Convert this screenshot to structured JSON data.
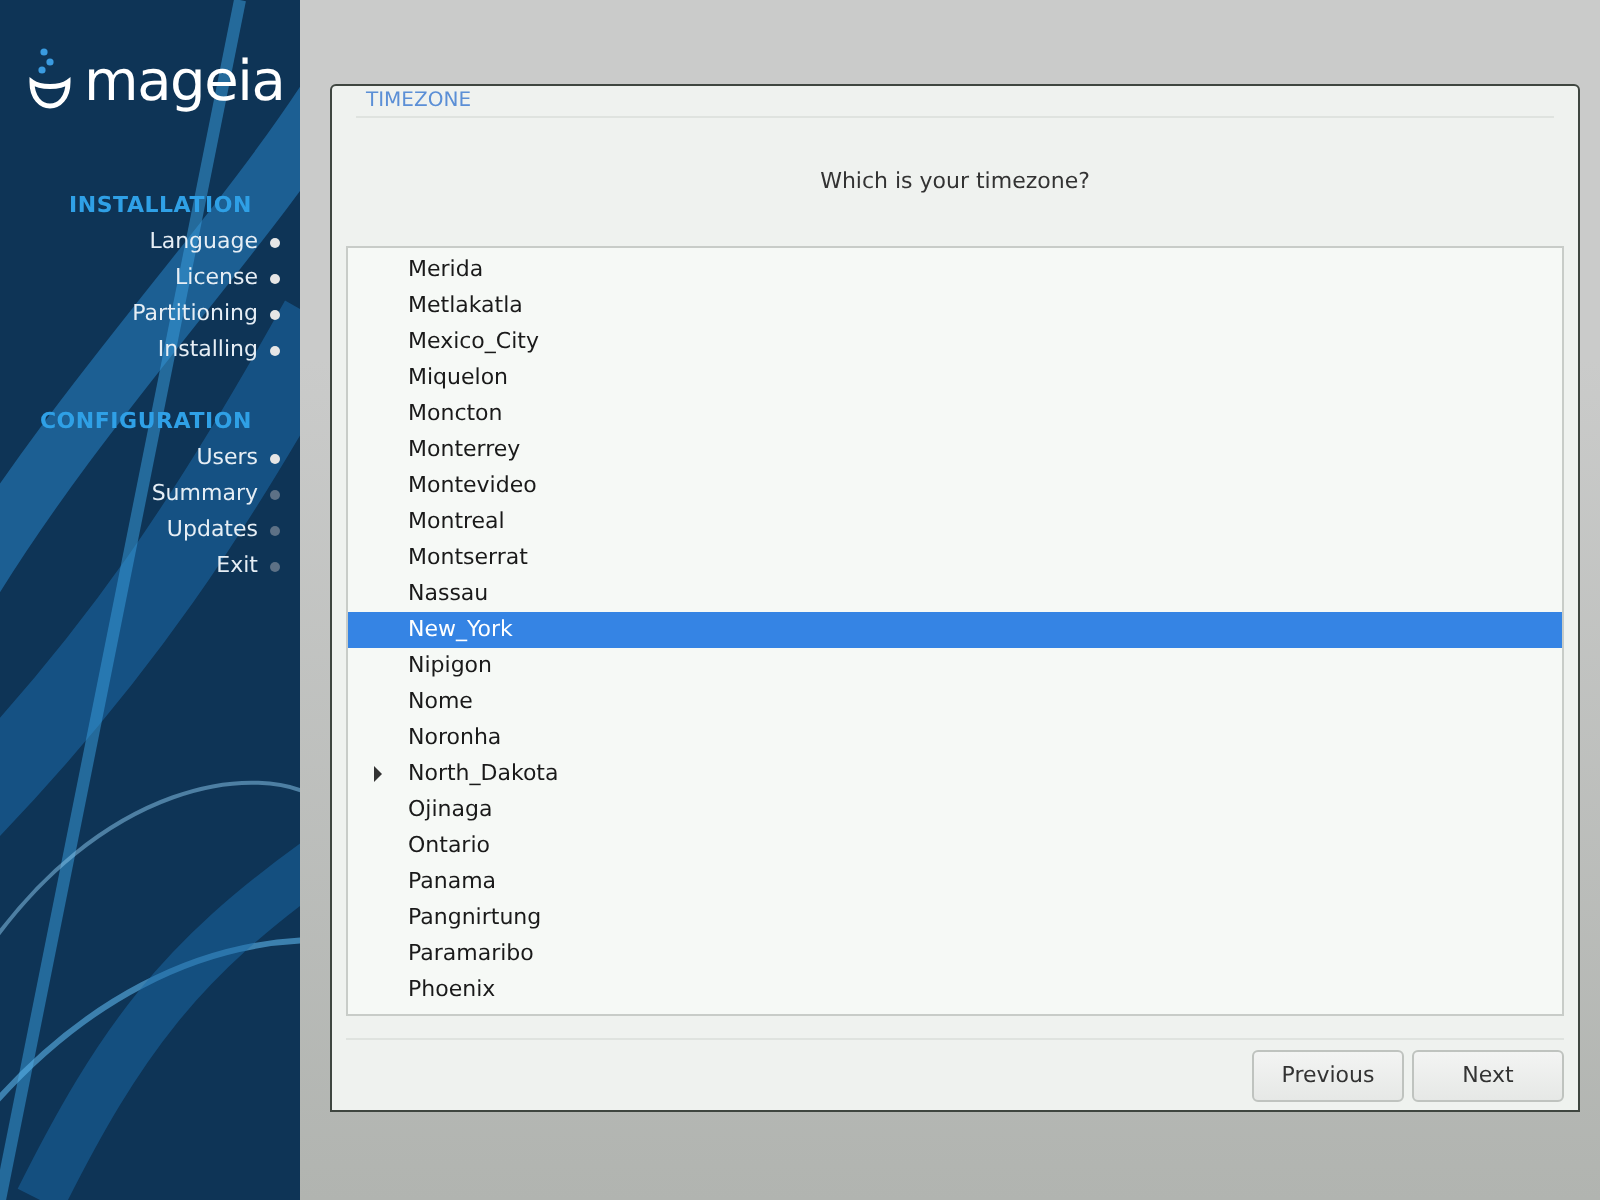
{
  "sidebar": {
    "logo": "mageia",
    "sections": [
      {
        "title": "INSTALLATION",
        "steps": [
          {
            "label": "Language",
            "done": true
          },
          {
            "label": "License",
            "done": true
          },
          {
            "label": "Partitioning",
            "done": true
          },
          {
            "label": "Installing",
            "done": true
          }
        ]
      },
      {
        "title": "CONFIGURATION",
        "steps": [
          {
            "label": "Users",
            "done": true
          },
          {
            "label": "Summary",
            "done": false
          },
          {
            "label": "Updates",
            "done": false
          },
          {
            "label": "Exit",
            "done": false
          }
        ]
      }
    ]
  },
  "dialog": {
    "title": "TIMEZONE",
    "question": "Which is your timezone?",
    "list": [
      {
        "label": "Merida",
        "kind": "leaf",
        "selected": false
      },
      {
        "label": "Metlakatla",
        "kind": "leaf",
        "selected": false
      },
      {
        "label": "Mexico_City",
        "kind": "leaf",
        "selected": false
      },
      {
        "label": "Miquelon",
        "kind": "leaf",
        "selected": false
      },
      {
        "label": "Moncton",
        "kind": "leaf",
        "selected": false
      },
      {
        "label": "Monterrey",
        "kind": "leaf",
        "selected": false
      },
      {
        "label": "Montevideo",
        "kind": "leaf",
        "selected": false
      },
      {
        "label": "Montreal",
        "kind": "leaf",
        "selected": false
      },
      {
        "label": "Montserrat",
        "kind": "leaf",
        "selected": false
      },
      {
        "label": "Nassau",
        "kind": "leaf",
        "selected": false
      },
      {
        "label": "New_York",
        "kind": "leaf",
        "selected": true
      },
      {
        "label": "Nipigon",
        "kind": "leaf",
        "selected": false
      },
      {
        "label": "Nome",
        "kind": "leaf",
        "selected": false
      },
      {
        "label": "Noronha",
        "kind": "leaf",
        "selected": false
      },
      {
        "label": "North_Dakota",
        "kind": "group",
        "expanded": false,
        "selected": false
      },
      {
        "label": "Ojinaga",
        "kind": "leaf",
        "selected": false
      },
      {
        "label": "Ontario",
        "kind": "leaf",
        "selected": false
      },
      {
        "label": "Panama",
        "kind": "leaf",
        "selected": false
      },
      {
        "label": "Pangnirtung",
        "kind": "leaf",
        "selected": false
      },
      {
        "label": "Paramaribo",
        "kind": "leaf",
        "selected": false
      },
      {
        "label": "Phoenix",
        "kind": "leaf",
        "selected": false
      }
    ],
    "buttons": [
      "Previous",
      "Next"
    ]
  }
}
